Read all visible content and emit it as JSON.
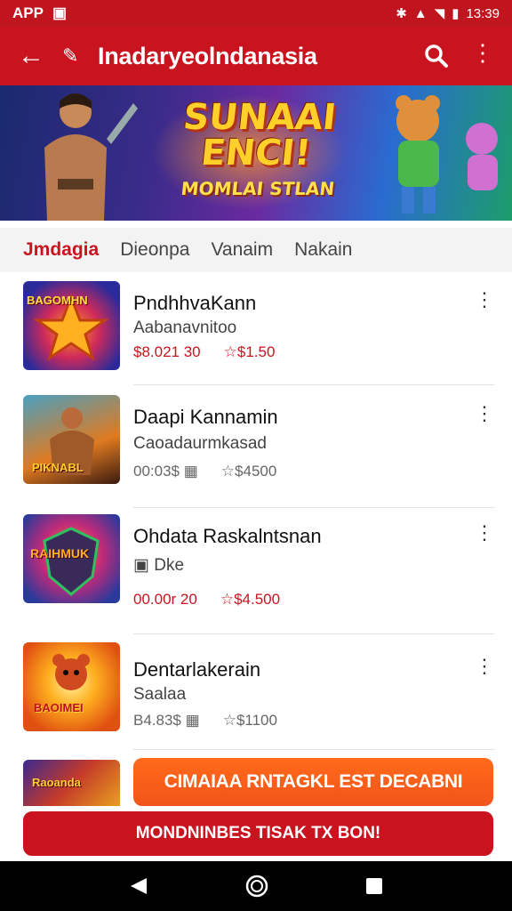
{
  "status": {
    "app": "APP",
    "time": "13:39"
  },
  "appbar": {
    "title": "Inadaryeolndanasia"
  },
  "banner": {
    "title": "SUNAAI ENCI!",
    "subtitle": "MOMLAI STLAN"
  },
  "tabs": [
    {
      "label": "Jmdagia"
    },
    {
      "label": "Dieonpa"
    },
    {
      "label": "Vanaim"
    },
    {
      "label": "Nakain"
    }
  ],
  "games": [
    {
      "name": "PndhhvaKann",
      "sub": "Aabanavnitoo",
      "price": "$8.021 30",
      "rating": "$1.50",
      "thumb_text": "BAGOMHN"
    },
    {
      "name": "Daapi Kannamin",
      "sub": "Caoadaurmkasad",
      "price": "00:03$",
      "rating": "$4500",
      "thumb_text": "PIKNABL"
    },
    {
      "name": "Ohdata Raskalntsnan",
      "sub": "Dke",
      "price": "00.00r 20",
      "rating": "$4.500",
      "thumb_text": "RAIHMUK"
    },
    {
      "name": "Dentarlakerain",
      "sub": "Saalaa",
      "price": "B4.83$",
      "rating": "$1100",
      "thumb_text": "BAOIMEI"
    }
  ],
  "promo_thumb_text": "Raoanda",
  "buttons": {
    "orange": "CIMAIAA RNTAGKL EST DECABNI",
    "red": "MONDNINBES TISAK TX BON!"
  },
  "colors": {
    "brand": "#c9141f",
    "accent": "#f2541a"
  }
}
